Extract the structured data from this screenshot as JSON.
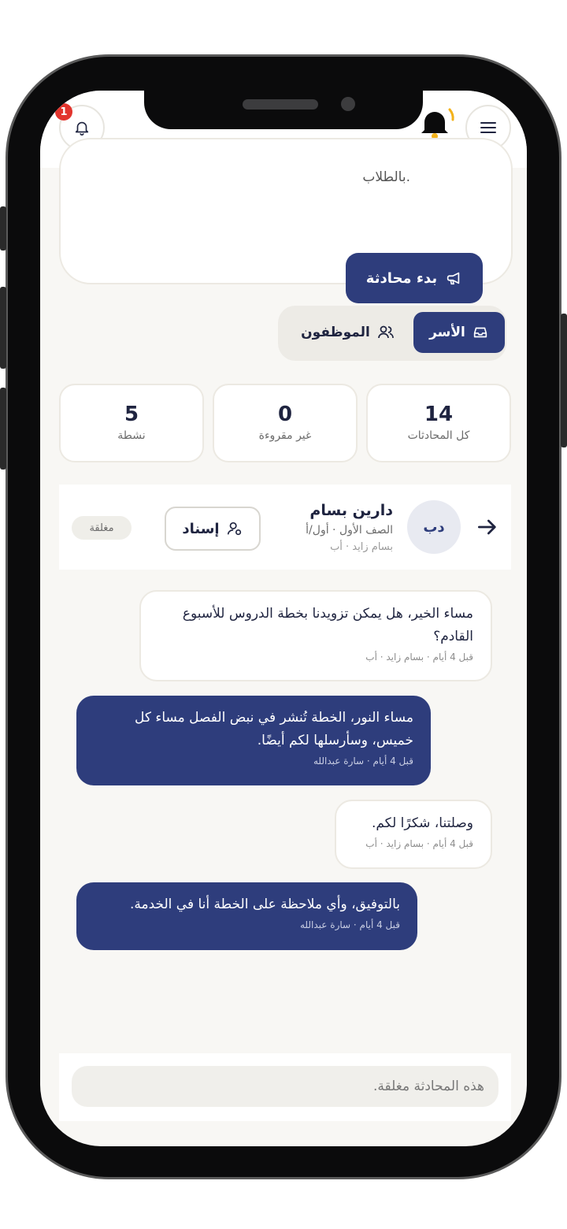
{
  "header": {
    "notification_count": "1",
    "menu_icon": "menu-icon",
    "bell_icon": "bell-icon"
  },
  "intro_card": {
    "text_fragment": "بالطلاب.",
    "start_button_label": "بدء محادثة"
  },
  "segments": {
    "families_label": "الأسر",
    "staff_label": "الموظفون"
  },
  "stats": [
    {
      "value": "14",
      "label": "كل المحادثات"
    },
    {
      "value": "0",
      "label": "غير مقروءة"
    },
    {
      "value": "5",
      "label": "نشطة"
    }
  ],
  "conversation": {
    "avatar_initials": "دب",
    "name": "دارين بسام",
    "class_info": "الصف الأول · أول/أ",
    "parent_info": "بسام زايد · أب",
    "assign_label": "إسناد",
    "status": "مغلقة"
  },
  "messages": [
    {
      "direction": "in",
      "text": "مساء الخير، هل يمكن تزويدنا بخطة الدروس للأسبوع القادم؟",
      "meta": "قبل 4 أيام · بسام زايد · أب"
    },
    {
      "direction": "out",
      "text": "مساء النور، الخطة تُنشر في نبض الفصل مساء كل خميس، وسأرسلها لكم أيضًا.",
      "meta": "قبل 4 أيام · سارة عبدالله"
    },
    {
      "direction": "in",
      "text": "وصلتنا، شكرًا لكم.",
      "meta": "قبل 4 أيام · بسام زايد · أب"
    },
    {
      "direction": "out",
      "text": "بالتوفيق، وأي ملاحظة على الخطة أنا في الخدمة.",
      "meta": "قبل 4 أيام · سارة عبدالله"
    }
  ],
  "composer": {
    "closed_text": "هذه المحادثة مغلقة."
  },
  "colors": {
    "primary": "#2e3d7c",
    "badge": "#e2342d",
    "bell_gold": "#f3b21a"
  }
}
